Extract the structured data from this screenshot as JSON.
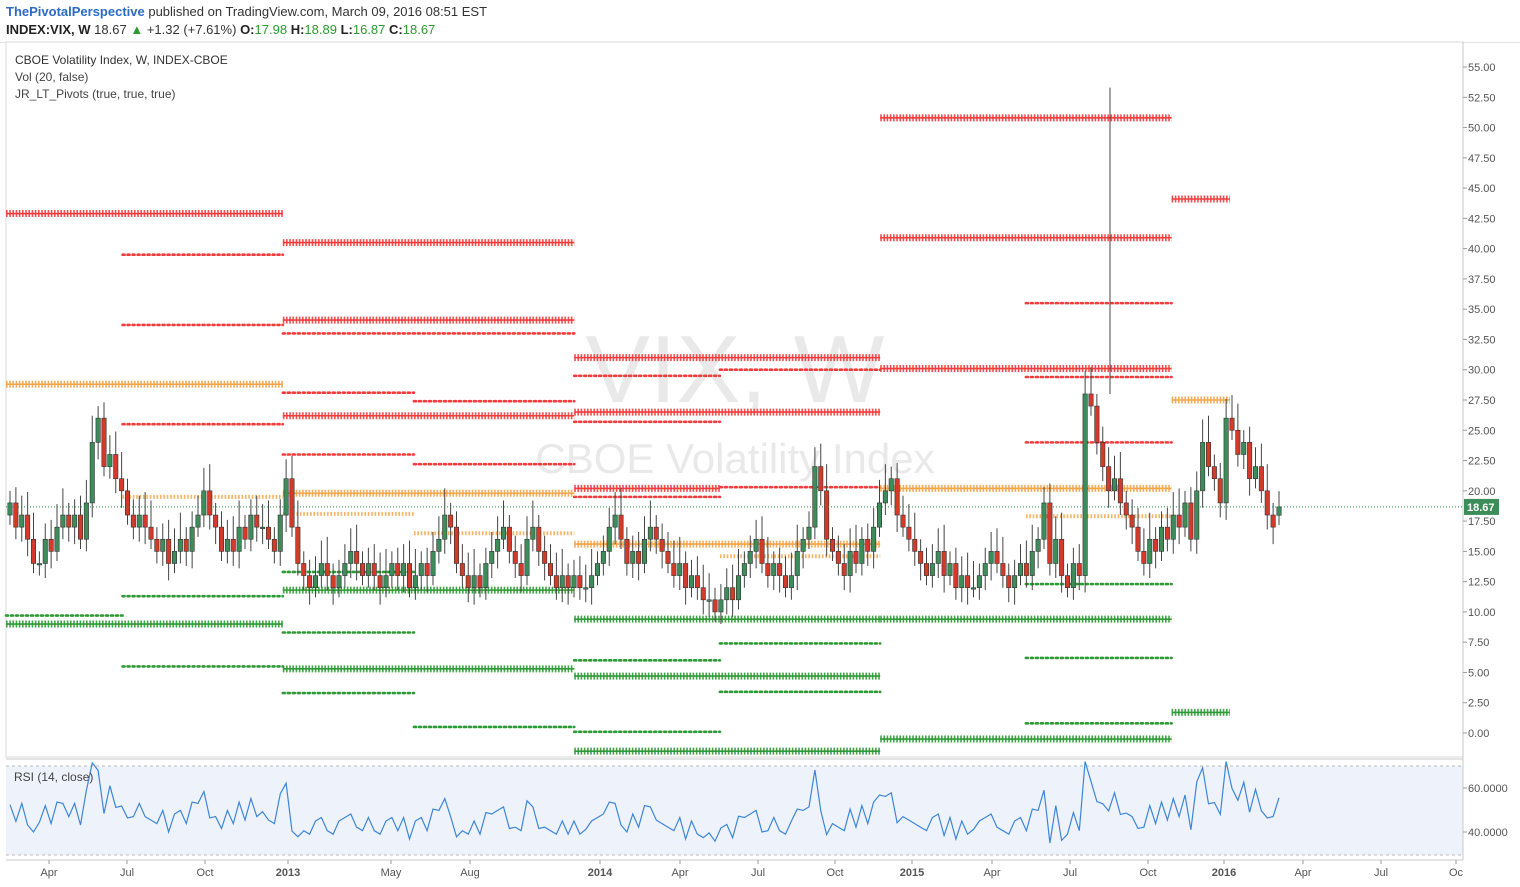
{
  "header": {
    "author": "ThePivotalPerspective",
    "published": " published on TradingView.com, March 09, 2016 08:51 EST",
    "symbol": "INDEX:VIX, W",
    "last": "18.67",
    "arrow": "▲",
    "change": "+1.32 (+7.61%)",
    "o_label": "O:",
    "o_val": "17.98",
    "h_label": "H:",
    "h_val": "18.89",
    "l_label": "L:",
    "l_val": "16.87",
    "c_label": "C:",
    "c_val": "18.67"
  },
  "legend": {
    "series": "CBOE Volatility Index, W, INDEX-CBOE",
    "vol": "Vol (20, false)",
    "pivots": "JR_LT_Pivots (true, true, true)",
    "rsi": "RSI (14, close)"
  },
  "watermark": {
    "big": "VIX, W",
    "small": "CBOE Volatility Index"
  },
  "colors": {
    "up": "#3d8d5a",
    "down": "#d43a2a",
    "red_pivot": "#f23c3c",
    "orange_pivot": "#f7a54a",
    "green_pivot": "#2e9a35",
    "rsi_line": "#3d85d8",
    "rsi_bg": "#eef3fb"
  },
  "chart_data": {
    "type": "candlestick",
    "price_axis": {
      "ticks": [
        "55.00",
        "52.50",
        "50.00",
        "47.50",
        "45.00",
        "42.50",
        "40.00",
        "37.50",
        "35.00",
        "32.50",
        "30.00",
        "27.50",
        "25.00",
        "22.50",
        "20.00",
        "17.50",
        "15.00",
        "12.50",
        "10.00",
        "7.50",
        "5.00",
        "2.50",
        "0.00"
      ],
      "ylim": [
        -2.5,
        56
      ]
    },
    "last_price": "18.67",
    "time_axis": [
      "Apr",
      "Jul",
      "Oct",
      "2013",
      "May",
      "Aug",
      "2014",
      "Apr",
      "Jul",
      "Oct",
      "2015",
      "Apr",
      "Jul",
      "Oct",
      "2016",
      "Apr",
      "Jul",
      "Oc"
    ],
    "rsi_axis": [
      "60.0000",
      "40.0000"
    ],
    "pivot_levels": [
      {
        "color": "red",
        "style": "heavy",
        "y": 42.9,
        "from": 0,
        "to": 0.19
      },
      {
        "color": "red",
        "style": "dot",
        "y": 39.5,
        "from": 0.08,
        "to": 0.19
      },
      {
        "color": "red",
        "style": "dot",
        "y": 33.7,
        "from": 0.08,
        "to": 0.19
      },
      {
        "color": "red",
        "style": "dot",
        "y": 25.5,
        "from": 0.08,
        "to": 0.19
      },
      {
        "color": "orange",
        "style": "heavy",
        "y": 28.8,
        "from": 0,
        "to": 0.19
      },
      {
        "color": "orange",
        "style": "medium",
        "y": 19.5,
        "from": 0.08,
        "to": 0.19
      },
      {
        "color": "green",
        "style": "dot",
        "y": 9.7,
        "from": 0,
        "to": 0.08
      },
      {
        "color": "green",
        "style": "heavy",
        "y": 9.0,
        "from": 0,
        "to": 0.19
      },
      {
        "color": "green",
        "style": "dot",
        "y": 11.3,
        "from": 0.08,
        "to": 0.19
      },
      {
        "color": "green",
        "style": "dot",
        "y": 5.5,
        "from": 0.08,
        "to": 0.19
      },
      {
        "color": "red",
        "style": "heavy",
        "y": 40.5,
        "from": 0.19,
        "to": 0.39
      },
      {
        "color": "red",
        "style": "heavy",
        "y": 34.1,
        "from": 0.19,
        "to": 0.39
      },
      {
        "color": "red",
        "style": "dot",
        "y": 33.0,
        "from": 0.19,
        "to": 0.39
      },
      {
        "color": "red",
        "style": "dot",
        "y": 28.1,
        "from": 0.19,
        "to": 0.28
      },
      {
        "color": "red",
        "style": "dot",
        "y": 27.4,
        "from": 0.28,
        "to": 0.39
      },
      {
        "color": "red",
        "style": "heavy",
        "y": 26.2,
        "from": 0.19,
        "to": 0.39
      },
      {
        "color": "red",
        "style": "dot",
        "y": 23.0,
        "from": 0.19,
        "to": 0.28
      },
      {
        "color": "red",
        "style": "dot",
        "y": 22.2,
        "from": 0.28,
        "to": 0.39
      },
      {
        "color": "orange",
        "style": "heavy",
        "y": 19.8,
        "from": 0.19,
        "to": 0.39
      },
      {
        "color": "orange",
        "style": "medium",
        "y": 18.1,
        "from": 0.19,
        "to": 0.28
      },
      {
        "color": "orange",
        "style": "medium",
        "y": 16.5,
        "from": 0.28,
        "to": 0.39
      },
      {
        "color": "green",
        "style": "dot",
        "y": 13.3,
        "from": 0.19,
        "to": 0.28
      },
      {
        "color": "green",
        "style": "heavy",
        "y": 11.8,
        "from": 0.19,
        "to": 0.39
      },
      {
        "color": "green",
        "style": "dot",
        "y": 8.3,
        "from": 0.19,
        "to": 0.28
      },
      {
        "color": "green",
        "style": "heavy",
        "y": 5.3,
        "from": 0.19,
        "to": 0.39
      },
      {
        "color": "green",
        "style": "dot",
        "y": 3.3,
        "from": 0.19,
        "to": 0.28
      },
      {
        "color": "green",
        "style": "dot",
        "y": 0.5,
        "from": 0.28,
        "to": 0.39
      },
      {
        "color": "red",
        "style": "heavy",
        "y": 31.0,
        "from": 0.39,
        "to": 0.6
      },
      {
        "color": "red",
        "style": "dot",
        "y": 29.5,
        "from": 0.39,
        "to": 0.49
      },
      {
        "color": "red",
        "style": "dot",
        "y": 30.0,
        "from": 0.49,
        "to": 0.6
      },
      {
        "color": "red",
        "style": "heavy",
        "y": 26.5,
        "from": 0.39,
        "to": 0.6
      },
      {
        "color": "red",
        "style": "dot",
        "y": 25.7,
        "from": 0.39,
        "to": 0.49
      },
      {
        "color": "red",
        "style": "heavy",
        "y": 20.2,
        "from": 0.39,
        "to": 0.49
      },
      {
        "color": "red",
        "style": "dot",
        "y": 19.5,
        "from": 0.39,
        "to": 0.49
      },
      {
        "color": "red",
        "style": "dot",
        "y": 20.3,
        "from": 0.49,
        "to": 0.6
      },
      {
        "color": "orange",
        "style": "heavy",
        "y": 15.6,
        "from": 0.39,
        "to": 0.6
      },
      {
        "color": "orange",
        "style": "medium",
        "y": 14.6,
        "from": 0.49,
        "to": 0.6
      },
      {
        "color": "green",
        "style": "heavy",
        "y": 9.4,
        "from": 0.39,
        "to": 0.6
      },
      {
        "color": "green",
        "style": "dot",
        "y": 7.4,
        "from": 0.49,
        "to": 0.6
      },
      {
        "color": "green",
        "style": "dot",
        "y": 6.0,
        "from": 0.39,
        "to": 0.49
      },
      {
        "color": "green",
        "style": "heavy",
        "y": 4.7,
        "from": 0.39,
        "to": 0.6
      },
      {
        "color": "green",
        "style": "dot",
        "y": 3.4,
        "from": 0.49,
        "to": 0.6
      },
      {
        "color": "green",
        "style": "dot",
        "y": 0.1,
        "from": 0.39,
        "to": 0.49
      },
      {
        "color": "green",
        "style": "heavy",
        "y": -1.5,
        "from": 0.39,
        "to": 0.6
      },
      {
        "color": "red",
        "style": "heavy",
        "y": 50.8,
        "from": 0.6,
        "to": 0.8
      },
      {
        "color": "red",
        "style": "heavy",
        "y": 40.9,
        "from": 0.6,
        "to": 0.8
      },
      {
        "color": "red",
        "style": "dot",
        "y": 35.5,
        "from": 0.7,
        "to": 0.8
      },
      {
        "color": "red",
        "style": "heavy",
        "y": 30.1,
        "from": 0.6,
        "to": 0.8
      },
      {
        "color": "red",
        "style": "dot",
        "y": 29.4,
        "from": 0.7,
        "to": 0.8
      },
      {
        "color": "red",
        "style": "dot",
        "y": 24.0,
        "from": 0.7,
        "to": 0.8
      },
      {
        "color": "orange",
        "style": "heavy",
        "y": 20.2,
        "from": 0.6,
        "to": 0.8
      },
      {
        "color": "orange",
        "style": "medium",
        "y": 17.9,
        "from": 0.7,
        "to": 0.8
      },
      {
        "color": "green",
        "style": "dot",
        "y": 12.3,
        "from": 0.7,
        "to": 0.8
      },
      {
        "color": "green",
        "style": "heavy",
        "y": 9.4,
        "from": 0.6,
        "to": 0.8
      },
      {
        "color": "green",
        "style": "dot",
        "y": 6.2,
        "from": 0.7,
        "to": 0.8
      },
      {
        "color": "green",
        "style": "dot",
        "y": 0.8,
        "from": 0.7,
        "to": 0.8
      },
      {
        "color": "green",
        "style": "heavy",
        "y": -0.5,
        "from": 0.6,
        "to": 0.8
      },
      {
        "color": "red",
        "style": "heavy",
        "y": 44.1,
        "from": 0.8,
        "to": 0.84
      },
      {
        "color": "orange",
        "style": "heavy",
        "y": 27.5,
        "from": 0.8,
        "to": 0.84
      },
      {
        "color": "green",
        "style": "heavy",
        "y": 1.7,
        "from": 0.8,
        "to": 0.84
      }
    ]
  }
}
